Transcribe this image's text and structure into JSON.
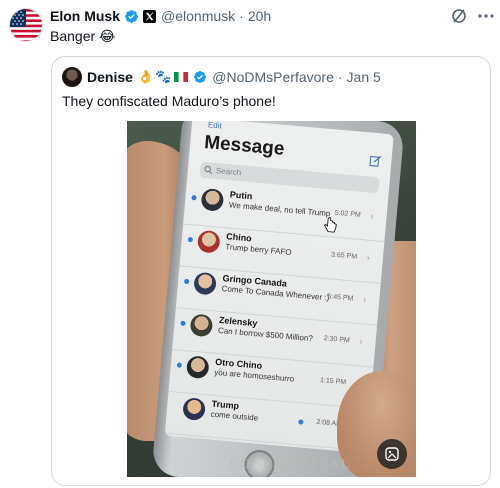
{
  "post": {
    "author_name": "Elon Musk",
    "handle": "@elonmusk",
    "separator": "·",
    "time": "20h",
    "text": "Banger 😂",
    "avatar_icon": "us-flag-avatar",
    "verified_color": "#1d9bf0",
    "org_badge_icon": "x-logo"
  },
  "quote": {
    "author_name": "Denise",
    "emojis": "👌🐾",
    "flag_icon": "italy-flag",
    "handle": "@NoDMsPerfavore",
    "separator": "·",
    "time": "Jan 5",
    "text": "They confiscated Maduro’s phone!"
  },
  "photo": {
    "screen_edit": "Edit",
    "screen_title": "Message",
    "search_placeholder": "Search",
    "watermark": "CONFIDENCIAL",
    "messages": [
      {
        "name": "Putin",
        "preview": "We make deal, no tell Trump",
        "time": "5:02 PM"
      },
      {
        "name": "Chino",
        "preview": "Trump berry FAFO",
        "time": "3:65 PM"
      },
      {
        "name": "Gringo Canada",
        "preview": "Come To Canada Whenever :)",
        "time": "5:45 PM"
      },
      {
        "name": "Zelensky",
        "preview": "Can I borrow $500 Million?",
        "time": "2:30 PM"
      },
      {
        "name": "Otro Chino",
        "preview": "you are homoseshurro",
        "time": "1:15 PM"
      },
      {
        "name": "Trump",
        "preview": "come outside",
        "time": "2:08 AM"
      }
    ]
  },
  "colors": {
    "text_primary": "#0f1419",
    "text_secondary": "#536471",
    "border": "#cfd9de",
    "accent": "#1d9bf0"
  }
}
